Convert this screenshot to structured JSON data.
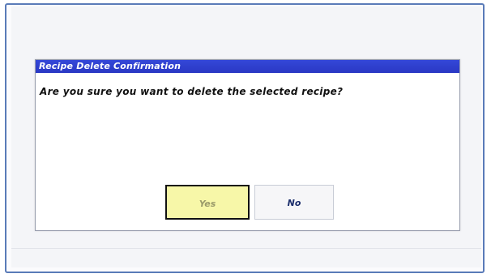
{
  "dialog": {
    "title": "Recipe Delete Confirmation",
    "message": "Are you sure you want to delete the selected recipe?",
    "buttons": {
      "yes_label": "Yes",
      "no_label": "No"
    }
  },
  "colors": {
    "title_bar": "#2a38c4",
    "yes_button_bg": "#f7f7a8",
    "frame_border": "#5a7bb8"
  }
}
